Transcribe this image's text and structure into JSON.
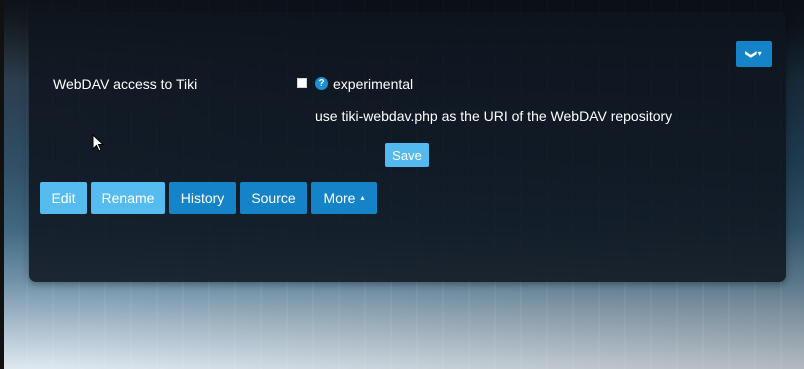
{
  "panel": {
    "dropdown_toggle": {
      "chevron": "❯",
      "caret": "▾",
      "icon": "chevron-down-icon"
    },
    "feature": {
      "label": "WebDAV access to Tiki",
      "checkbox_checked": false,
      "help_icon": "question-circle-icon",
      "help_glyph": "?",
      "status": "experimental",
      "hint": "use tiki-webdav.php as the URI of the WebDAV repository"
    },
    "save_label": "Save"
  },
  "actions": {
    "edit": "Edit",
    "rename": "Rename",
    "history": "History",
    "source": "Source",
    "more": "More",
    "more_caret": "▴"
  },
  "colors": {
    "primary": "#1583c7",
    "primary_light": "#56bcef",
    "panel_bg": "#0e151e",
    "text": "#ffffff"
  }
}
